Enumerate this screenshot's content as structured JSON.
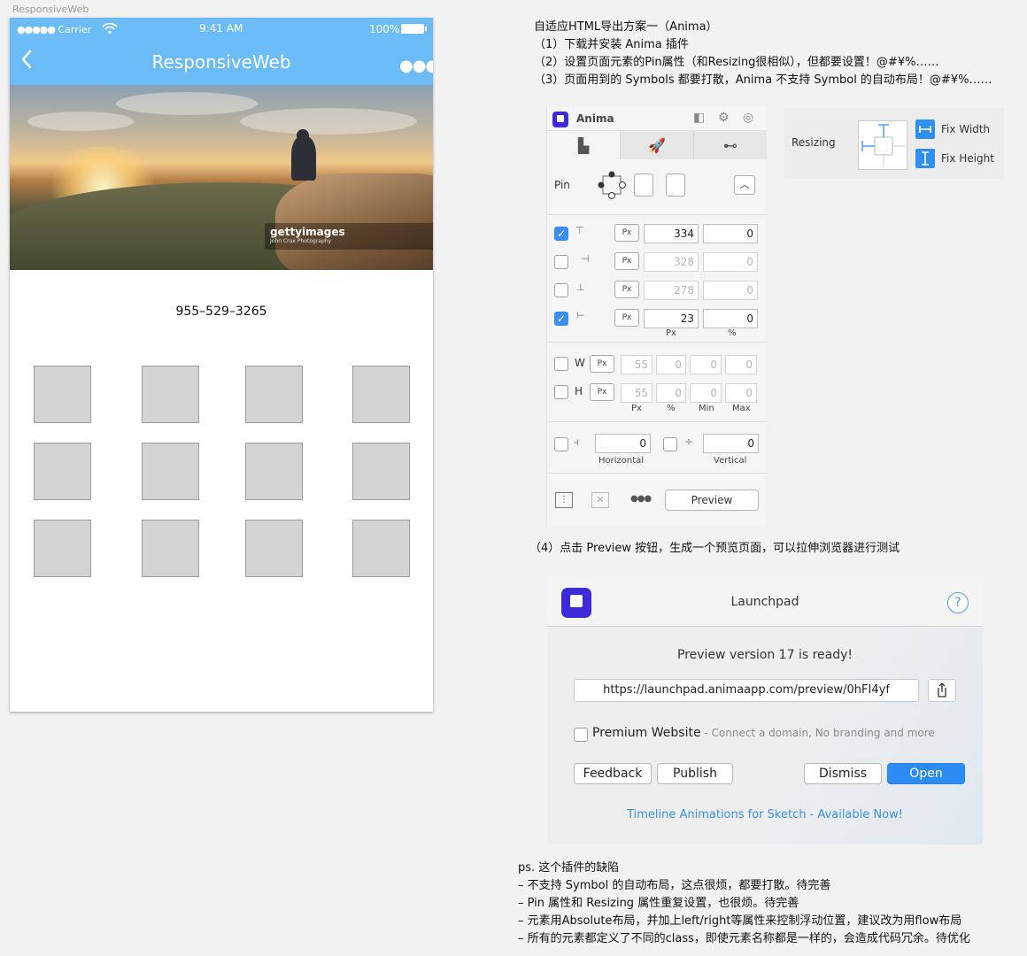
{
  "artboard": {
    "label": "ResponsiveWeb"
  },
  "phone": {
    "status": {
      "carrier": "Carrier",
      "time": "9:41 AM",
      "battery": "100%"
    },
    "nav": {
      "title": "ResponsiveWeb"
    },
    "watermark": {
      "brand": "gettyimages",
      "credit": "John Crux Photography"
    },
    "phone_number": "955–529–3265",
    "grid": {
      "rows": 3,
      "cols": 4
    }
  },
  "notes": {
    "heading": "自适应HTML导出方案一（Anima）",
    "steps": [
      "（1）下载并安装 Anima 插件",
      "（2）设置页面元素的Pin属性（和Resizing很相似），但都要设置！@#¥%……",
      "（3）页面用到的 Symbols 都要打散，Anima 不支持 Symbol 的自动布局！@#¥%……"
    ],
    "step4": "（4）点击 Preview 按钮，生成一个预览页面，可以拉伸浏览器进行测试",
    "ps_title": "ps. 这个插件的缺陷",
    "ps_items": [
      "– 不支持 Symbol 的自动布局，这点很烦，都要打散。待完善",
      "– Pin 属性和 Resizing 属性重复设置，也很烦。待完善",
      "– 元素用Absolute布局，并加上left/right等属性来控制浮动位置，建议改为用flow布局",
      "– 所有的元素都定义了不同的class，即使元素名称都是一样的，会造成代码冗余。待优化"
    ]
  },
  "anima": {
    "title": "Anima",
    "pin_label": "Pin",
    "unit_px": "Px",
    "rows": [
      {
        "checked": true,
        "px": "334",
        "pct": "0"
      },
      {
        "checked": false,
        "px": "328",
        "pct": "0"
      },
      {
        "checked": false,
        "px": "278",
        "pct": "0"
      },
      {
        "checked": true,
        "px": "23",
        "pct": "0"
      }
    ],
    "col_px": "Px",
    "col_pct": "%",
    "w_label": "W",
    "h_label": "H",
    "w_vals": [
      "55",
      "0",
      "0",
      "0"
    ],
    "h_vals": [
      "55",
      "0",
      "0",
      "0"
    ],
    "size_cols": [
      "Px",
      "%",
      "Min",
      "Max"
    ],
    "horizontal_val": "0",
    "vertical_val": "0",
    "horizontal_label": "Horizontal",
    "vertical_label": "Vertical",
    "preview": "Preview"
  },
  "resizing": {
    "label": "Resizing",
    "fix_width": "Fix Width",
    "fix_height": "Fix Height"
  },
  "launchpad": {
    "title": "Launchpad",
    "help": "?",
    "ready": "Preview version 17 is ready!",
    "url": "https://launchpad.animaapp.com/preview/0hFI4yf",
    "premium": "Premium Website",
    "premium_note": " - Connect a domain, No branding and more",
    "feedback": "Feedback",
    "publish": "Publish",
    "dismiss": "Dismiss",
    "open": "Open",
    "link": "Timeline Animations for Sketch - Available Now!"
  },
  "colors": {
    "nav": "#6bbcf6",
    "accent": "#2d8cf2",
    "anima_brand": "#3d2bd8"
  }
}
